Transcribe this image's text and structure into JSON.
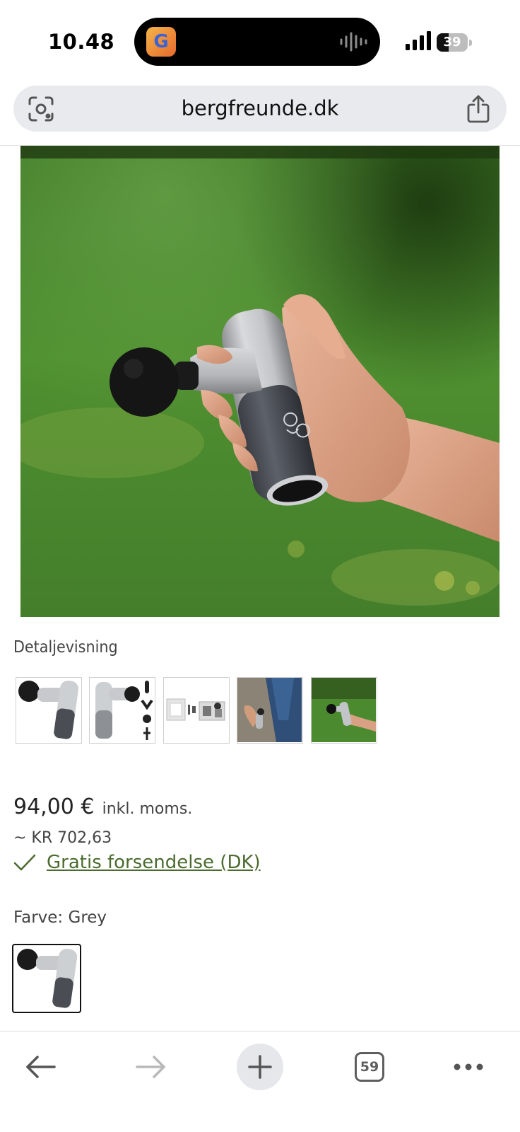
{
  "status_bar": {
    "time": "10.48",
    "island_app_icon": "G",
    "battery_level": "39"
  },
  "browser": {
    "url": "bergfreunde.dk",
    "left_icon": "visual-search-icon",
    "right_icon": "share-icon"
  },
  "product": {
    "detail_view_label": "Detaljevisning",
    "thumbnails": [
      "thumbnail-product-grey",
      "thumbnail-product-attachments",
      "thumbnail-product-box",
      "thumbnail-leg-massage",
      "thumbnail-hand-outdoor"
    ],
    "price": "94,00 €",
    "vat_label": "inkl. moms.",
    "approx_price": "~ KR 702,63",
    "shipping_link": "Gratis forsendelse (DK)",
    "color_label": "Farve: Grey"
  },
  "toolbar": {
    "tab_count": "59",
    "icons": [
      "back-arrow-icon",
      "forward-arrow-icon",
      "plus-icon",
      "tabs-icon",
      "more-icon"
    ]
  },
  "colors": {
    "accent_link": "#4b6b2f",
    "url_bar_bg": "#e8eaed"
  }
}
